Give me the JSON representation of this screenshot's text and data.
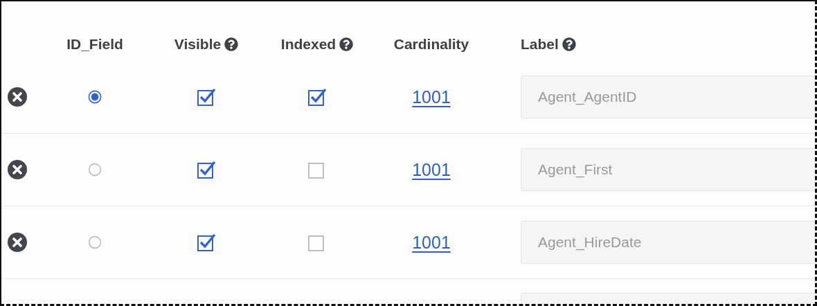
{
  "columns": [
    {
      "label": "ID_Field",
      "help": false
    },
    {
      "label": "Visible",
      "help": true
    },
    {
      "label": "Indexed",
      "help": true
    },
    {
      "label": "Cardinality",
      "help": false
    },
    {
      "label": "Label",
      "help": true
    }
  ],
  "rows": [
    {
      "kind": "full",
      "id_field_selected": true,
      "visible_checked": true,
      "indexed_checked": true,
      "cardinality": "1001",
      "label": "Agent_AgentID"
    },
    {
      "kind": "full",
      "id_field_selected": false,
      "visible_checked": true,
      "indexed_checked": false,
      "cardinality": "1001",
      "label": "Agent_First"
    },
    {
      "kind": "full",
      "id_field_selected": false,
      "visible_checked": true,
      "indexed_checked": false,
      "cardinality": "1001",
      "label": "Agent_HireDate"
    },
    {
      "kind": "partial"
    }
  ]
}
